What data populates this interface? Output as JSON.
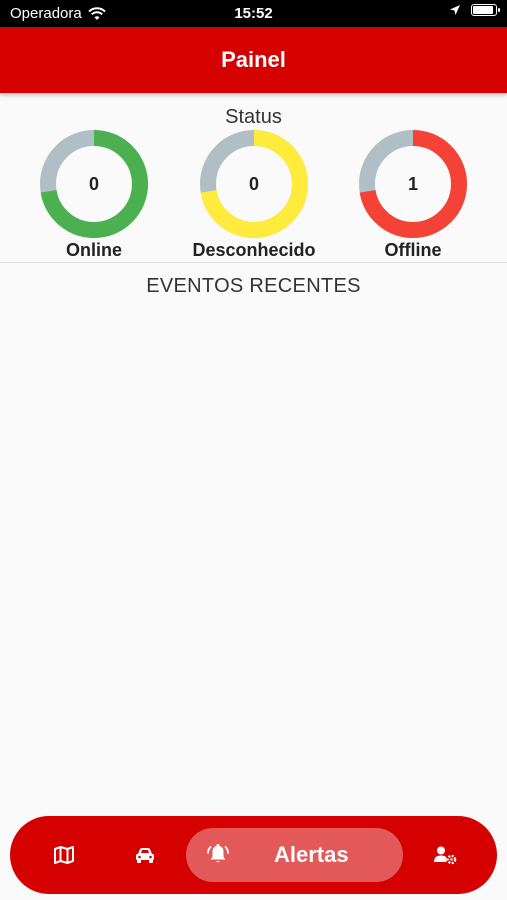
{
  "status_bar": {
    "carrier": "Operadora",
    "time": "15:52"
  },
  "app_bar": {
    "title": "Painel"
  },
  "status_section": {
    "title": "Status",
    "gauges": [
      {
        "label": "Online",
        "value": "0",
        "color": "#4caf50"
      },
      {
        "label": "Desconhecido",
        "value": "0",
        "color": "#ffeb3b"
      },
      {
        "label": "Offline",
        "value": "1",
        "color": "#f44336"
      }
    ],
    "track_color": "#b0bec5"
  },
  "events_section": {
    "title": "EVENTOS RECENTES"
  },
  "bottom_nav": {
    "items": [
      {
        "icon": "map-icon"
      },
      {
        "icon": "car-icon"
      },
      {
        "icon": "bell-icon",
        "label": "Alertas",
        "active": true
      },
      {
        "icon": "user-settings-icon"
      }
    ],
    "background": "#d50000"
  }
}
